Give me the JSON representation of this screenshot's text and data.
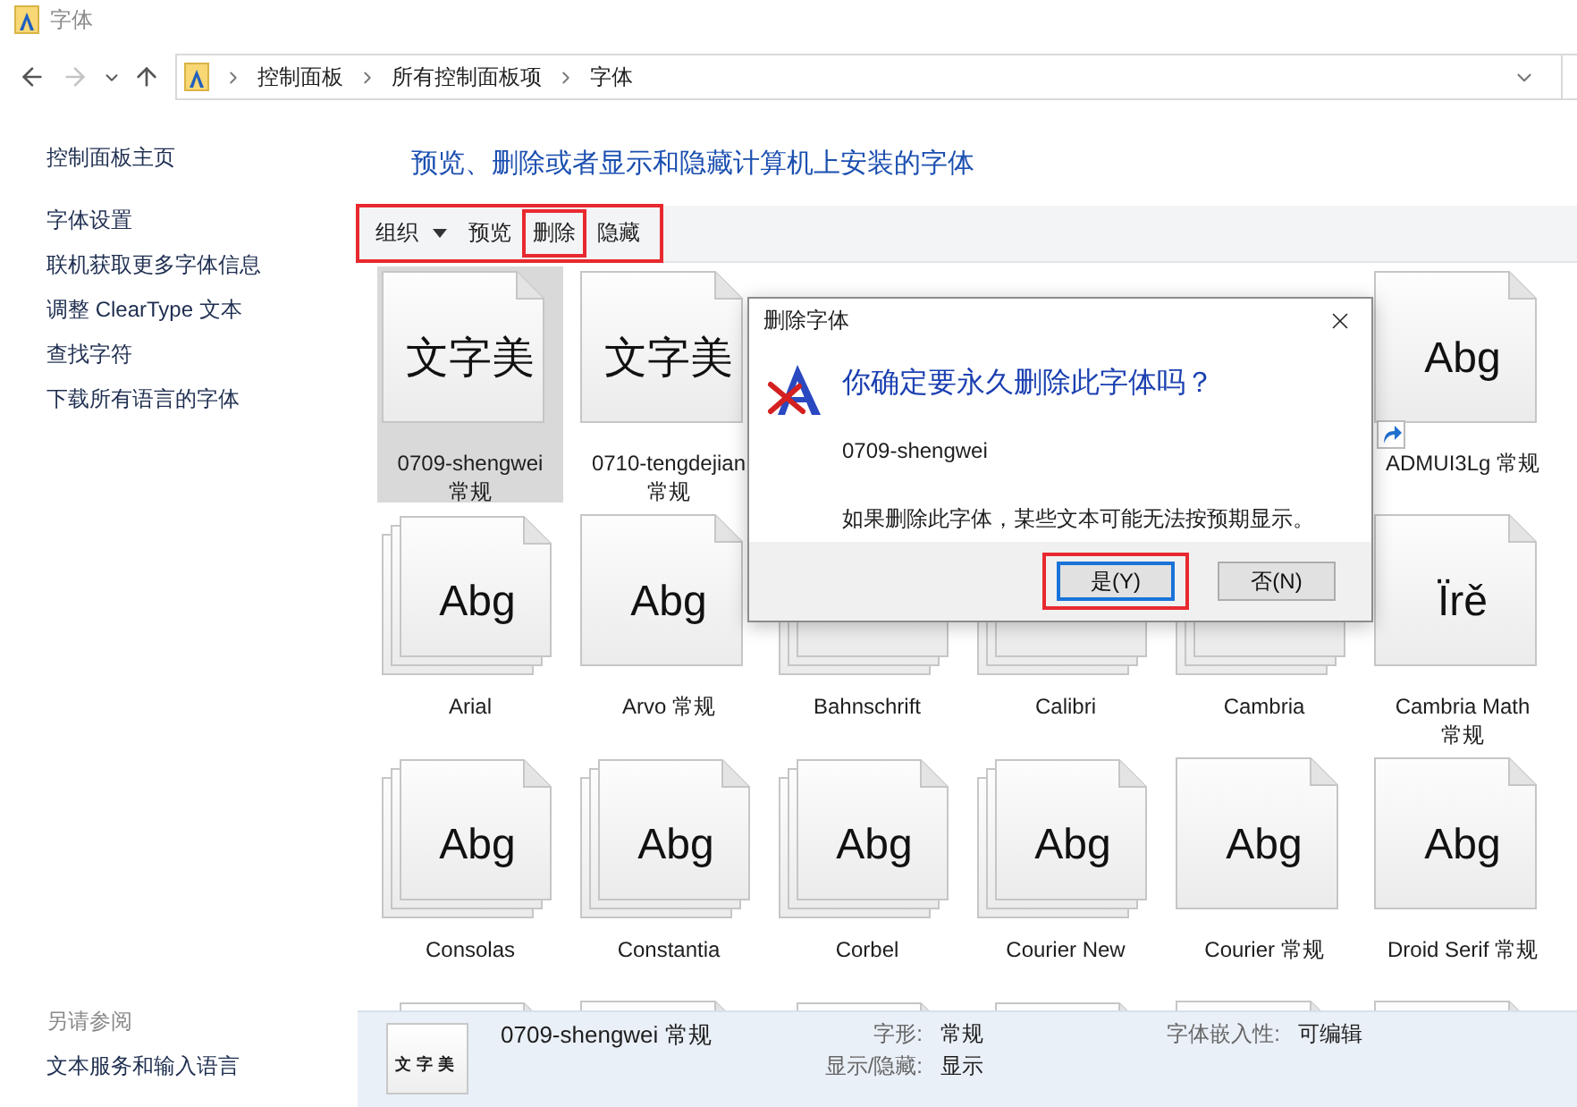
{
  "window": {
    "title": "字体"
  },
  "navigation": {
    "back_disabled": false,
    "forward_disabled": true
  },
  "address_bar": {
    "path": [
      "控制面板",
      "所有控制面板项",
      "字体"
    ]
  },
  "sidebar": {
    "links": [
      "控制面板主页",
      "字体设置",
      "联机获取更多字体信息",
      "调整 ClearType 文本",
      "查找字符",
      "下载所有语言的字体"
    ],
    "see_also": {
      "heading": "另请参阅",
      "links": [
        "文本服务和输入语言"
      ]
    }
  },
  "heading": "预览、删除或者显示和隐藏计算机上安装的字体",
  "toolbar": {
    "highlighted": true,
    "items": [
      {
        "label": "组织",
        "kind": "menu",
        "highlighted": false
      },
      {
        "label": "预览",
        "kind": "button",
        "highlighted": false
      },
      {
        "label": "删除",
        "kind": "button",
        "highlighted": true
      },
      {
        "label": "隐藏",
        "kind": "button",
        "highlighted": false
      }
    ]
  },
  "fonts": [
    {
      "kind": "tile",
      "label": "0709-shengwei 常规",
      "sample": "文字美",
      "stacked": false,
      "selected": true,
      "shortcut": false
    },
    {
      "kind": "tile",
      "label": "0710-tengdejian 常规",
      "sample": "文字美",
      "stacked": false,
      "selected": false,
      "shortcut": false
    },
    {
      "kind": "covered"
    },
    {
      "kind": "covered"
    },
    {
      "kind": "covered"
    },
    {
      "kind": "tile",
      "label": "ADMUI3Lg 常规",
      "sample": "Abg",
      "stacked": false,
      "selected": false,
      "shortcut": true
    },
    {
      "kind": "tile",
      "label": "Arial",
      "sample": "Abg",
      "stacked": true,
      "selected": false,
      "shortcut": false
    },
    {
      "kind": "tile",
      "label": "Arvo 常规",
      "sample": "Abg",
      "stacked": false,
      "selected": false,
      "shortcut": false
    },
    {
      "kind": "tile",
      "label": "Bahnschrift",
      "stacked": true,
      "selected": false,
      "shortcut": false
    },
    {
      "kind": "tile",
      "label": "Calibri",
      "stacked": true,
      "selected": false,
      "shortcut": false
    },
    {
      "kind": "tile",
      "label": "Cambria",
      "stacked": true,
      "selected": false,
      "shortcut": false
    },
    {
      "kind": "tile",
      "label": "Cambria Math 常规",
      "sample": "Ïrě",
      "stacked": false,
      "selected": false,
      "shortcut": false
    },
    {
      "kind": "tile",
      "label": "Consolas",
      "sample": "Abg",
      "stacked": true,
      "selected": false,
      "shortcut": false
    },
    {
      "kind": "tile",
      "label": "Constantia",
      "sample": "Abg",
      "stacked": true,
      "selected": false,
      "shortcut": false
    },
    {
      "kind": "tile",
      "label": "Corbel",
      "sample": "Abg",
      "stacked": true,
      "selected": false,
      "shortcut": false
    },
    {
      "kind": "tile",
      "label": "Courier New",
      "sample": "Abg",
      "stacked": true,
      "selected": false,
      "shortcut": false
    },
    {
      "kind": "tile",
      "label": "Courier 常规",
      "sample": "Abg",
      "stacked": false,
      "selected": false,
      "shortcut": false
    },
    {
      "kind": "tile",
      "label": "Droid Serif 常规",
      "sample": "Abg",
      "stacked": false,
      "selected": false,
      "shortcut": false
    },
    {
      "kind": "tile",
      "stacked": true,
      "selected": false
    },
    {
      "kind": "tile",
      "stacked": false,
      "selected": false
    },
    {
      "kind": "tile",
      "stacked": true,
      "selected": false
    },
    {
      "kind": "tile",
      "stacked": true,
      "selected": false
    },
    {
      "kind": "tile",
      "stacked": false,
      "selected": false
    },
    {
      "kind": "tile",
      "stacked": false,
      "selected": false
    }
  ],
  "dialog": {
    "title": "删除字体",
    "question": "你确定要永久删除此字体吗？",
    "font_name": "0709-shengwei",
    "message": "如果删除此字体，某些文本可能无法按预期显示。",
    "buttons": [
      {
        "label": "是(Y)",
        "default": true,
        "highlighted": true
      },
      {
        "label": "否(N)",
        "default": false,
        "highlighted": false
      }
    ]
  },
  "details": {
    "sample": "文字美",
    "name": "0709-shengwei 常规",
    "fields": [
      {
        "label": "字形:",
        "value": "常规"
      },
      {
        "label": "显示/隐藏:",
        "value": "显示"
      },
      {
        "label": "字体嵌入性:",
        "value": "可编辑"
      }
    ]
  }
}
